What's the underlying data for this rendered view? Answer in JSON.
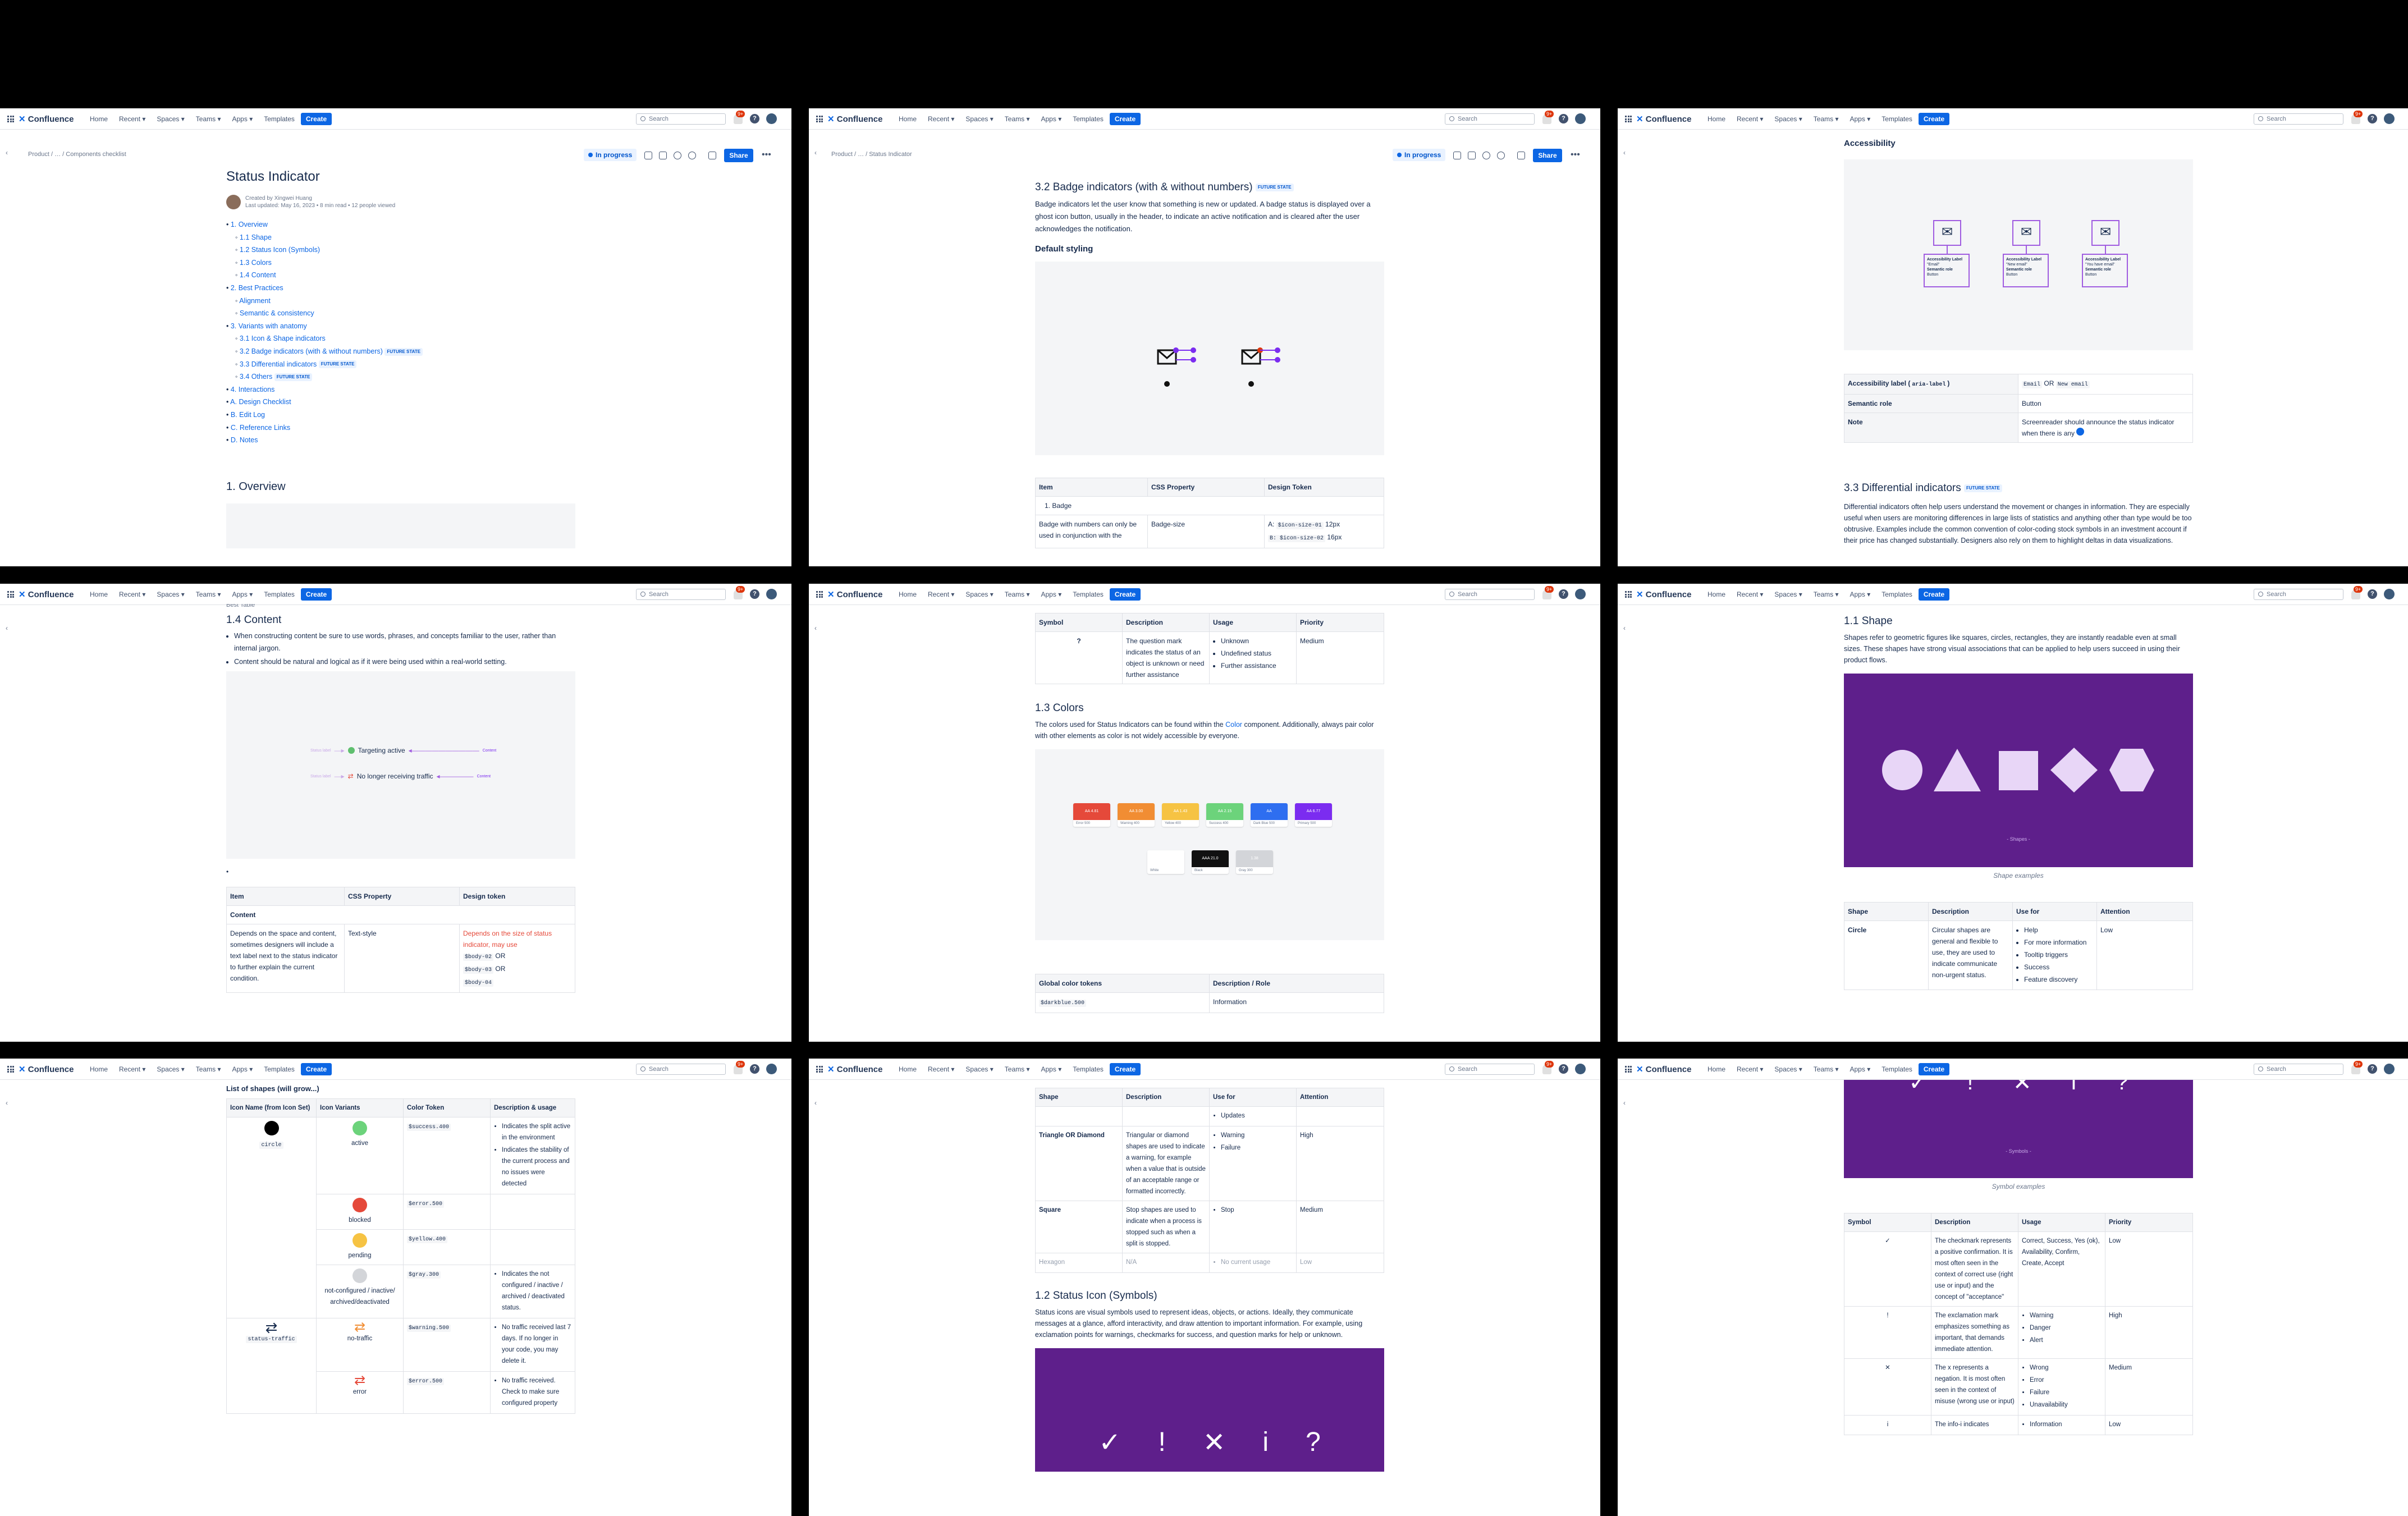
{
  "nav": {
    "logo": "Confluence",
    "items": [
      "Home",
      "Recent",
      "Spaces",
      "Teams",
      "Apps",
      "Templates"
    ],
    "create": "Create",
    "search_placeholder": "Search",
    "notif": "9+",
    "help": "?"
  },
  "page_header": {
    "breadcrumb": "Product  /  …  /  Components checklist",
    "breadcrumb_p2": "Product  /  …  /  Status Indicator",
    "status": "In progress",
    "share": "Share"
  },
  "p1": {
    "title": "Status Indicator",
    "meta1": "Created by Xingwei Huang",
    "meta2": "Last updated: May 16, 2023 • 8 min read  •  12 people viewed",
    "toc": [
      "1. Overview",
      "1.1 Shape",
      "1.2 Status Icon (Symbols)",
      "1.3 Colors",
      "1.4 Content",
      "2. Best Practices",
      "Alignment",
      "Semantic & consistency",
      "3. Variants with anatomy",
      "3.1 Icon & Shape indicators",
      "3.2 Badge indicators (with & without numbers)",
      "3.3 Differential indicators",
      "3.4 Others",
      "4. Interactions",
      "A. Design Checklist",
      "B. Edit Log",
      "C. Reference Links",
      "D. Notes"
    ],
    "future": "FUTURE STATE",
    "section": "1. Overview"
  },
  "p2": {
    "title": "3.2 Badge indicators (with & without numbers)",
    "future": "FUTURE STATE",
    "body": "Badge indicators let the user know that something is new or updated. A badge status is displayed over a ghost icon button, usually in the header, to indicate an active notification and is cleared after the user acknowledges the notification.",
    "sub": "Default styling",
    "table": {
      "headers": [
        "Item",
        "CSS Property",
        "Design Token"
      ],
      "row1": "1. Badge",
      "c1": "Badge with numbers can only be used in conjunction with the",
      "c2": "Badge-size",
      "c3a": "A:",
      "c3code": "$icon-size-01",
      "c3b": "12px",
      "c3code2": "B: $icon-size-02",
      "c3c": "16px"
    }
  },
  "p3": {
    "title": "Accessibility",
    "cards": [
      {
        "label": "Accessibility Label",
        "v": "\"Email\"",
        "role": "Semantic role",
        "rv": "Button"
      },
      {
        "label": "Accessibility Label",
        "v": "\"New email\"",
        "role": "Semantic role",
        "rv": "Button"
      },
      {
        "label": "Accessibility Label",
        "v": "\"You have email\"",
        "role": "Semantic role",
        "rv": "Button"
      }
    ],
    "table": [
      {
        "k": "Accessibility label (",
        "kc": "aria-label",
        "k2": ")",
        "v1": "Email",
        "or": "OR",
        "v2": "New email"
      },
      {
        "k": "Semantic role",
        "v": "Button"
      },
      {
        "k": "Note",
        "v": "Screenreader should announce the status indicator when there is any"
      }
    ],
    "s2": "3.3 Differential indicators",
    "future": "FUTURE STATE",
    "body": "Differential indicators often help users understand the movement or changes in information. They are especially useful when users are monitoring differences in large lists of statistics and anything other than type would be too obtrusive. Examples include the common convention of color-coding stock symbols in an investment account if their price has changed substantially. Designers also rely on them to highlight deltas in data visualizations."
  },
  "p4": {
    "partial": "Best Table",
    "title": "1.4 Content",
    "b1": "When constructing content be sure to use words, phrases, and concepts familiar to the user, rather than internal jargon.",
    "b2": "Content should be natural and logical as if it were being used within a real-world setting.",
    "ex1": "Targeting active",
    "ex2": "No longer receiving traffic",
    "exl": "Status label",
    "exr": "Content",
    "table": {
      "headers": [
        "Item",
        "CSS Property",
        "Design token"
      ],
      "group": "Content",
      "c1": "Depends on the space and content, sometimes designers will include a text label next to the status indicator to further explain the current condition.",
      "c2": "Text-style",
      "c3": "Depends on the size of status indicator, may use",
      "t1": "$body-02",
      "or": "OR",
      "t2": "$body-03",
      "t3": "$body-04"
    }
  },
  "p5": {
    "table": {
      "headers": [
        "Symbol",
        "Description",
        "Usage",
        "Priority"
      ],
      "sym": "?",
      "desc": "The question mark indicates the status of an object is unknown or need further assistance",
      "usage": [
        "Unknown",
        "Undefined status",
        "Further assistance"
      ],
      "prio": "Medium"
    },
    "title": "1.3 Colors",
    "body1": "The colors used for Status Indicators can be found within the ",
    "body_link": "Color",
    "body2": " component. Additionally, always pair color with other elements as color is not widely accessible by everyone.",
    "swatches": [
      {
        "n": "Error 500",
        "t": "AA 4.81",
        "c": "#e5493a"
      },
      {
        "n": "Warning 400",
        "t": "AA 3.00",
        "c": "#f18d33"
      },
      {
        "n": "Yellow 400",
        "t": "AA 1.43",
        "c": "#f6c343"
      },
      {
        "n": "Success 400",
        "t": "AA 2.15",
        "c": "#6cd37b"
      },
      {
        "n": "Dark Blue 500",
        "t": "AA",
        "c": "#2e6ef0"
      },
      {
        "n": "Primary 500",
        "t": "AA 6.77",
        "c": "#7b2cf0"
      },
      {
        "n": "White",
        "t": "AAA 21.0",
        "c": "#ffffff"
      },
      {
        "n": "Black",
        "t": "AAA 21.0",
        "c": "#111111"
      },
      {
        "n": "Gray 300",
        "t": "1.38",
        "c": "#d3d5d9"
      }
    ],
    "table2": {
      "headers": [
        "Global color tokens",
        "Description / Role"
      ],
      "r1c1": "$darkblue.500",
      "r1c2": "Information"
    }
  },
  "p6": {
    "title": "1.1 Shape",
    "body": "Shapes refer to geometric figures like squares, circles, rectangles, they are instantly readable even at small sizes. These shapes have strong visual associations that can be applied to help users succeed in using their product flows.",
    "img_caption": "- Shapes -",
    "caption": "Shape examples",
    "table": {
      "headers": [
        "Shape",
        "Description",
        "Use for",
        "Attention"
      ],
      "shape": "Circle",
      "desc": "Circular shapes are general and flexible to use, they are used to indicate communicate non-urgent status.",
      "use": [
        "Help",
        "For more information",
        "Tooltip triggers",
        "Success",
        "Feature discovery"
      ],
      "att": "Low"
    }
  },
  "p7": {
    "title": "List of shapes  (will grow...)",
    "headers": [
      "Icon Name (from Icon Set)",
      "Icon Variants",
      "Color Token",
      "Description & usage"
    ],
    "rows": [
      {
        "name": "circle",
        "variant": "active",
        "token": "$success.400",
        "desc": [
          "Indicates the split active in the environment",
          "Indicates the stability of the current process and no issues were detected"
        ]
      },
      {
        "variant": "blocked",
        "token": "$error.500"
      },
      {
        "variant": "pending",
        "token": "$yellow.400"
      },
      {
        "variant": "not-configured / inactive/ archived/deactivated",
        "token": "$gray.300",
        "desc": [
          "Indicates the not configured / inactive / archived / deactivated status."
        ]
      },
      {
        "name": "status-traffic",
        "variant": "no-traffic",
        "token": "$warning.500",
        "desc": [
          "No traffic received last 7 days. If no longer in your code, you may delete it."
        ]
      },
      {
        "variant": "error",
        "token": "$error.500",
        "desc": [
          "No traffic received. Check to make sure configured property"
        ]
      }
    ]
  },
  "p8": {
    "table": {
      "headers": [
        "Shape",
        "Description",
        "Use for",
        "Attention"
      ],
      "r0": "Updates",
      "r1": {
        "shape": "Triangle OR Diamond",
        "desc": "Triangular or diamond shapes are used to indicate a warning, for example when a value that is outside of an acceptable range or formatted incorrectly.",
        "use": [
          "Warning",
          "Failure"
        ],
        "att": "High"
      },
      "r2": {
        "shape": "Square",
        "desc": "Stop shapes are used to indicate when a process is stopped such as when a split is stopped.",
        "use": [
          "Stop"
        ],
        "att": "Medium"
      },
      "r3": {
        "shape": "Hexagon",
        "desc": "N/A",
        "use": [
          "No current usage"
        ],
        "att": "Low"
      }
    },
    "title": "1.2 Status Icon (Symbols)",
    "body": "Status icons are visual symbols used to represent ideas, objects, or actions. Ideally, they communicate messages at a glance, afford interactivity, and draw attention to important information. For example, using exclamation points for warnings, checkmarks for success, and question marks for help or unknown.",
    "symbols": [
      "✓",
      "!",
      "✕",
      "i",
      "?"
    ]
  },
  "p9": {
    "img_caption": "- Symbols -",
    "caption": "Symbol examples",
    "symbols": [
      "✓",
      "!",
      "✕",
      "i",
      "?"
    ],
    "headers": [
      "Symbol",
      "Description",
      "Usage",
      "Priority"
    ],
    "rows": [
      {
        "s": "✓",
        "d": "The checkmark represents a positive confirmation. It is most often seen in the context of correct use (right use or input) and the concept of \"acceptance\"",
        "u": "Correct, Success, Yes (ok), Availability, Confirm, Create, Accept",
        "p": "Low"
      },
      {
        "s": "!",
        "d": "The exclamation mark emphasizes something as important, that demands immediate attention.",
        "ul": [
          "Warning",
          "Danger",
          "Alert"
        ],
        "p": "High"
      },
      {
        "s": "✕",
        "d": "The x represents a negation. It is most often seen in the context of misuse (wrong use or input)",
        "ul": [
          "Wrong",
          "Error",
          "Failure",
          "Unavailability"
        ],
        "p": "Medium"
      },
      {
        "s": "i",
        "d": "The info-i indicates",
        "ul": [
          "Information"
        ],
        "p": "Low"
      }
    ]
  }
}
